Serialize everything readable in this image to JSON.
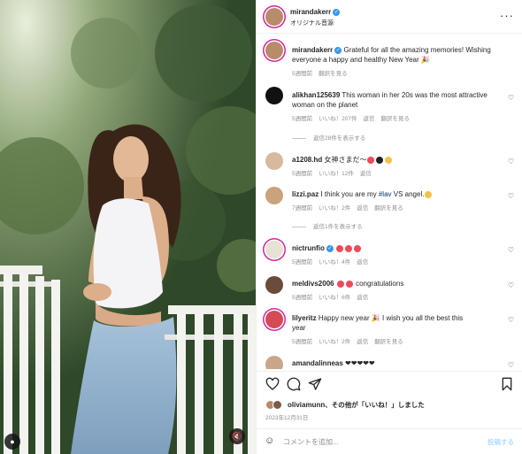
{
  "post": {
    "username": "mirandakerr",
    "audio": "オリジナル音源",
    "more": "···"
  },
  "caption": {
    "username": "mirandakerr",
    "text": "Grateful for all the amazing memories! Wishing everyone a happy and healthy New Year 🎉",
    "age": "5週間前",
    "translate": "翻訳を見る"
  },
  "comments": [
    {
      "username": "alikhan125639",
      "text": "This woman in her 20s was the most attractive woman on the planet",
      "age": "5週間前",
      "likes": "いいね！207件",
      "reply": "返信",
      "translate": "翻訳を見る",
      "view_replies": "返信28件を表示する"
    },
    {
      "username": "a1208.hd",
      "text": "女神さまだ～",
      "age": "5週間前",
      "likes": "いいね！12件",
      "reply": "返信"
    },
    {
      "username": "lizzi.paz",
      "text_before": "I think you are my",
      "hashtag": "#lav",
      "text_after": "VS angel.",
      "age": "7週間前",
      "likes": "いいね！2件",
      "reply": "返信",
      "translate": "翻訳を見る",
      "view_replies": "返信1件を表示する"
    },
    {
      "username": "nictrunfio",
      "age": "5週間前",
      "likes": "いいね！4件",
      "reply": "返信"
    },
    {
      "username": "meldivs2006",
      "text": "congratulations",
      "age": "5週間前",
      "likes": "いいね！6件",
      "reply": "返信"
    },
    {
      "username": "lilyeritz",
      "text": "Happy new year 🎉 I wish you all the best this year",
      "age": "5週間前",
      "likes": "いいね！2件",
      "reply": "返信",
      "translate": "翻訳を見る"
    },
    {
      "username": "amandalinneas",
      "text": "❤❤❤❤❤"
    }
  ],
  "likes": {
    "user": "oliviamunn",
    "text": "、その他が「いいね！」しました",
    "date": "2023年12月31日"
  },
  "add_comment": {
    "placeholder": "コメントを追加...",
    "post_label": "投稿する"
  },
  "colors": {
    "verified": "#3897f0",
    "post_disabled": "#b2dffc",
    "story_ring": "#d6249f"
  }
}
